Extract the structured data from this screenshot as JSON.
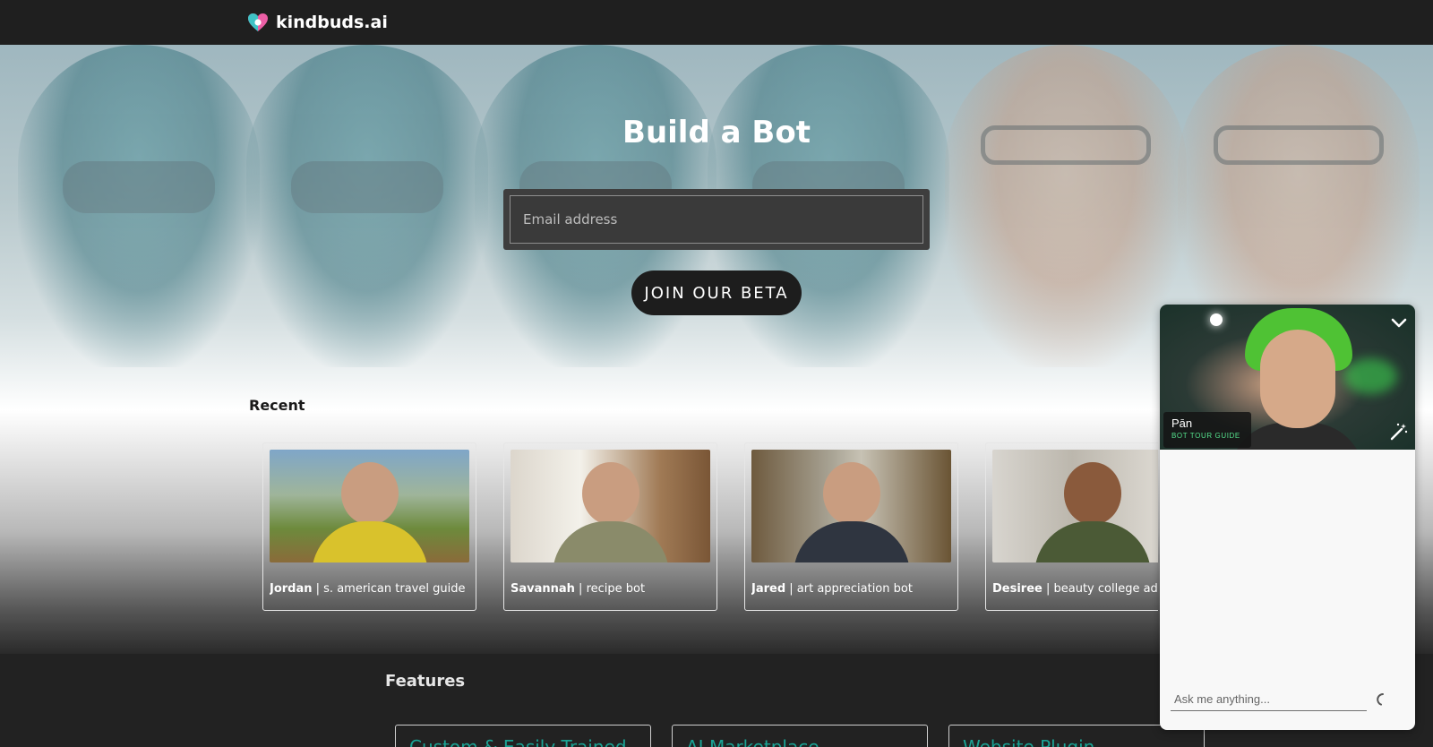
{
  "header": {
    "brand_name": "kindbuds.ai",
    "logo_icon": "heart-logo-icon",
    "background": "#1f1f1f"
  },
  "hero": {
    "title": "Build a Bot",
    "email_placeholder": "Email address",
    "join_button_label": "JOIN OUR BETA"
  },
  "recent": {
    "title": "Recent",
    "bots": [
      {
        "name": "Jordan",
        "description": " | s. american travel guide"
      },
      {
        "name": "Savannah",
        "description": " | recipe bot"
      },
      {
        "name": "Jared",
        "description": " | art appreciation bot"
      },
      {
        "name": "Desiree",
        "description": " | beauty college advisor"
      }
    ]
  },
  "features": {
    "title": "Features",
    "items": [
      "Custom & Easily Trained",
      "AI Marketplace",
      "Website Plugin"
    ]
  },
  "chat_widget": {
    "bot_name": "Pān",
    "bot_role": "BOT TOUR GUIDE",
    "input_placeholder": "Ask me anything...",
    "accent_color": "#55e08c",
    "icons": [
      "chevron-down-icon",
      "magic-wand-icon",
      "loading-spinner-icon"
    ]
  },
  "colors": {
    "feature_text": "#1aa394",
    "button_background": "#1d1d1d"
  }
}
